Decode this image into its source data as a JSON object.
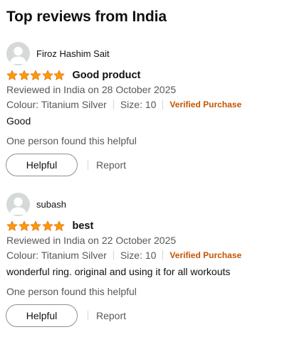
{
  "section_title": "Top reviews from India",
  "colors": {
    "star_fill": "#ff9900",
    "star_stroke": "#de7921",
    "verified": "#c45500",
    "secondary_text": "#565959",
    "avatar_bg": "#d5d9d9"
  },
  "reviews": [
    {
      "reviewer": "Firoz Hashim Sait",
      "rating": 5,
      "title": "Good product",
      "date": "Reviewed in India on 28 October 2025",
      "colour": "Colour: Titanium Silver",
      "size": "Size: 10",
      "verified": "Verified Purchase",
      "body": "Good",
      "helpful_count": "One person found this helpful",
      "helpful_label": "Helpful",
      "report_label": "Report"
    },
    {
      "reviewer": "subash",
      "rating": 5,
      "title": "best",
      "date": "Reviewed in India on 22 October 2025",
      "colour": "Colour: Titanium Silver",
      "size": "Size: 10",
      "verified": "Verified Purchase",
      "body": "wonderful ring. original and using it for all workouts",
      "helpful_count": "One person found this helpful",
      "helpful_label": "Helpful",
      "report_label": "Report"
    }
  ]
}
